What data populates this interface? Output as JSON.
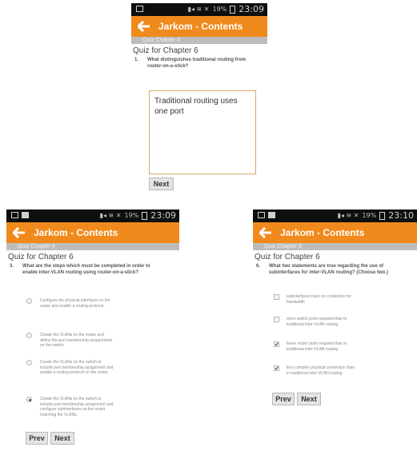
{
  "app": {
    "title": "Jarkom - Contents",
    "subheader": "Quiz Chapter 6",
    "quiz_heading": "Quiz for Chapter 6"
  },
  "status": {
    "time_1": "23:09",
    "time_2": "23:09",
    "time_3": "23:10",
    "battery": "19%"
  },
  "screen1": {
    "question_number": "1.",
    "question": "What distinguishes traditional routing from router-on-a-stick?",
    "answer": "Traditional routing uses one port",
    "next_label": "Next"
  },
  "screen2": {
    "question_number": "3.",
    "question": "What are the steps which must be completed in order to enable inter-VLAN routing using router-on-a-stick?",
    "options": [
      {
        "text": "Configure the physical interfaces on the router and enable a routing protocol.",
        "selected": false
      },
      {
        "text": "Create the VLANs on the router and define the port membership assignments on the switch.",
        "selected": false
      },
      {
        "text": "Create the VLANs on the switch to include port membership assignment and enable a routing protocol on the router.",
        "selected": false
      },
      {
        "text": "Create the VLANs on the switch to include port membership assignment and configure subinterfaces on the router matching the VLANs.",
        "selected": true
      }
    ],
    "prev_label": "Prev",
    "next_label": "Next"
  },
  "screen3": {
    "question_number": "6.",
    "question": "What two statements are true regarding the use of subinterfaces for inter-VLAN routing? (Choose two.)",
    "options": [
      {
        "text": "subinterfaces have no contention for bandwidth",
        "checked": false
      },
      {
        "text": "more switch ports required than in traditional inter-VLAN routing",
        "checked": false
      },
      {
        "text": "fewer router ports required than in traditional inter-VLAN routing",
        "checked": true
      },
      {
        "text": "less complex physical connection than in traditional inter-VLAN routing",
        "checked": true
      }
    ],
    "prev_label": "Prev",
    "next_label": "Next"
  },
  "colors": {
    "appbar": "#f08a1c",
    "statusbar": "#0e0e0e",
    "subbar": "#bdbdbd",
    "answer_border": "#d8a86b"
  },
  "icons": {
    "back": "arrow-left-icon"
  }
}
